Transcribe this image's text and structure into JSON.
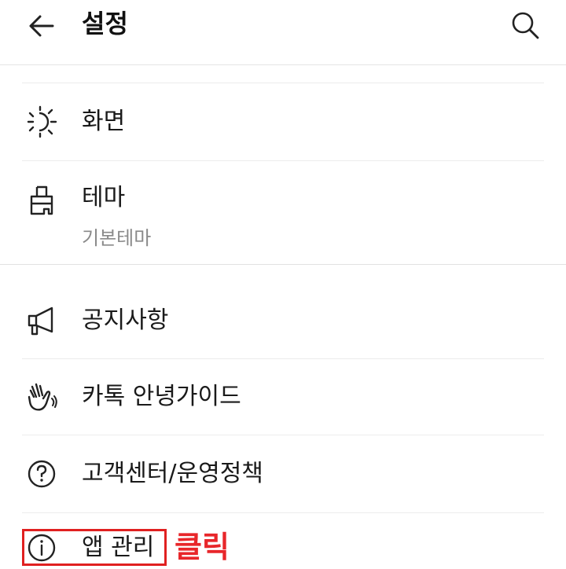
{
  "header": {
    "title": "설정",
    "back_icon": "arrow-left-icon",
    "search_icon": "search-icon"
  },
  "items": [
    {
      "label": "화면",
      "icon": "sun-icon"
    },
    {
      "label": "테마",
      "subtitle": "기본테마",
      "icon": "paint-brush-icon"
    },
    {
      "label": "공지사항",
      "icon": "megaphone-icon"
    },
    {
      "label": "카톡 안녕가이드",
      "icon": "waving-hand-icon"
    },
    {
      "label": "고객센터/운영정책",
      "icon": "question-circle-icon"
    },
    {
      "label": "앱 관리",
      "icon": "info-circle-icon"
    }
  ],
  "annotation": {
    "click_label": "클릭",
    "color": "#e8262a"
  }
}
